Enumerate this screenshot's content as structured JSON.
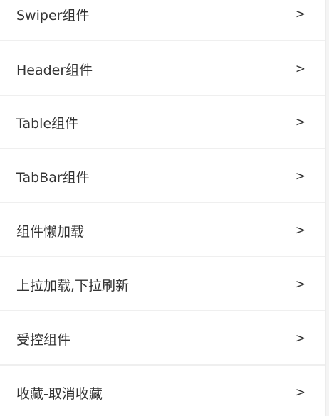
{
  "menu": {
    "items": [
      {
        "label": "Swiper组件",
        "chevron": ">"
      },
      {
        "label": "Header组件",
        "chevron": ">"
      },
      {
        "label": "Table组件",
        "chevron": ">"
      },
      {
        "label": "TabBar组件",
        "chevron": ">"
      },
      {
        "label": "组件懒加载",
        "chevron": ">"
      },
      {
        "label": "上拉加载,下拉刷新",
        "chevron": ">"
      },
      {
        "label": "受控组件",
        "chevron": ">"
      },
      {
        "label": "收藏-取消收藏",
        "chevron": ">"
      }
    ]
  }
}
